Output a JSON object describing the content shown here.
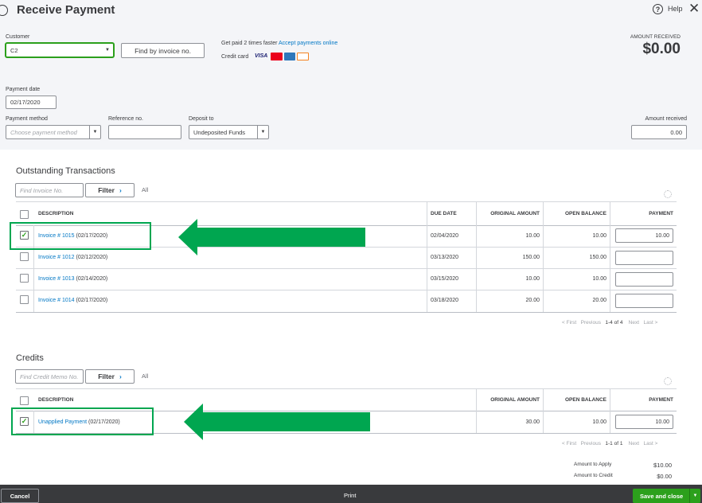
{
  "header": {
    "title": "Receive Payment",
    "help_label": "Help",
    "amount_received_caption": "AMOUNT RECEIVED",
    "amount_received_value": "$0.00"
  },
  "customer": {
    "label": "Customer",
    "value": "C2",
    "find_button": "Find by invoice no."
  },
  "promo": {
    "text": "Get paid 2 times faster",
    "link": "Accept payments online",
    "credit_card_label": "Credit card",
    "cards": [
      "VISA",
      "MC",
      "AMEX",
      "DISC"
    ]
  },
  "payment_date": {
    "label": "Payment date",
    "value": "02/17/2020"
  },
  "payment_method": {
    "label": "Payment method",
    "placeholder": "Choose payment method"
  },
  "reference": {
    "label": "Reference no.",
    "value": ""
  },
  "deposit_to": {
    "label": "Deposit to",
    "value": "Undeposited Funds"
  },
  "amount_received": {
    "label": "Amount received",
    "value": "0.00"
  },
  "outstanding": {
    "title": "Outstanding Transactions",
    "search_placeholder": "Find Invoice No.",
    "filter_label": "Filter",
    "all_label": "All",
    "columns": [
      "DESCRIPTION",
      "DUE DATE",
      "ORIGINAL AMOUNT",
      "OPEN BALANCE",
      "PAYMENT"
    ],
    "rows": [
      {
        "checked": true,
        "link": "Invoice # 1015",
        "date": "(02/17/2020)",
        "due": "02/04/2020",
        "original": "10.00",
        "open": "10.00",
        "payment": "10.00"
      },
      {
        "checked": false,
        "link": "Invoice # 1012",
        "date": "(02/12/2020)",
        "due": "03/13/2020",
        "original": "150.00",
        "open": "150.00",
        "payment": ""
      },
      {
        "checked": false,
        "link": "Invoice # 1013",
        "date": "(02/14/2020)",
        "due": "03/15/2020",
        "original": "10.00",
        "open": "10.00",
        "payment": ""
      },
      {
        "checked": false,
        "link": "Invoice # 1014",
        "date": "(02/17/2020)",
        "due": "03/18/2020",
        "original": "20.00",
        "open": "20.00",
        "payment": ""
      }
    ],
    "pager": {
      "first": "< First",
      "previous": "Previous",
      "range": "1-4 of 4",
      "next": "Next",
      "last": "Last >"
    }
  },
  "credits": {
    "title": "Credits",
    "search_placeholder": "Find Credit Memo No.",
    "filter_label": "Filter",
    "all_label": "All",
    "columns": [
      "DESCRIPTION",
      "ORIGINAL AMOUNT",
      "OPEN BALANCE",
      "PAYMENT"
    ],
    "rows": [
      {
        "checked": true,
        "link": "Unapplied Payment",
        "date": "(02/17/2020)",
        "original": "30.00",
        "open": "10.00",
        "payment": "10.00"
      }
    ],
    "pager": {
      "first": "< First",
      "previous": "Previous",
      "range": "1-1 of 1",
      "next": "Next",
      "last": "Last >"
    }
  },
  "totals": {
    "apply_label": "Amount to Apply",
    "apply_value": "$10.00",
    "credit_label": "Amount to Credit",
    "credit_value": "$0.00"
  },
  "footer": {
    "cancel": "Cancel",
    "print": "Print",
    "save": "Save and close"
  },
  "colors": {
    "header_bg": "#f4f5f8",
    "accent_green": "#2ca01c",
    "annotation_green": "#00a650",
    "footer_bg": "#393a3d",
    "link": "#0077c5"
  }
}
